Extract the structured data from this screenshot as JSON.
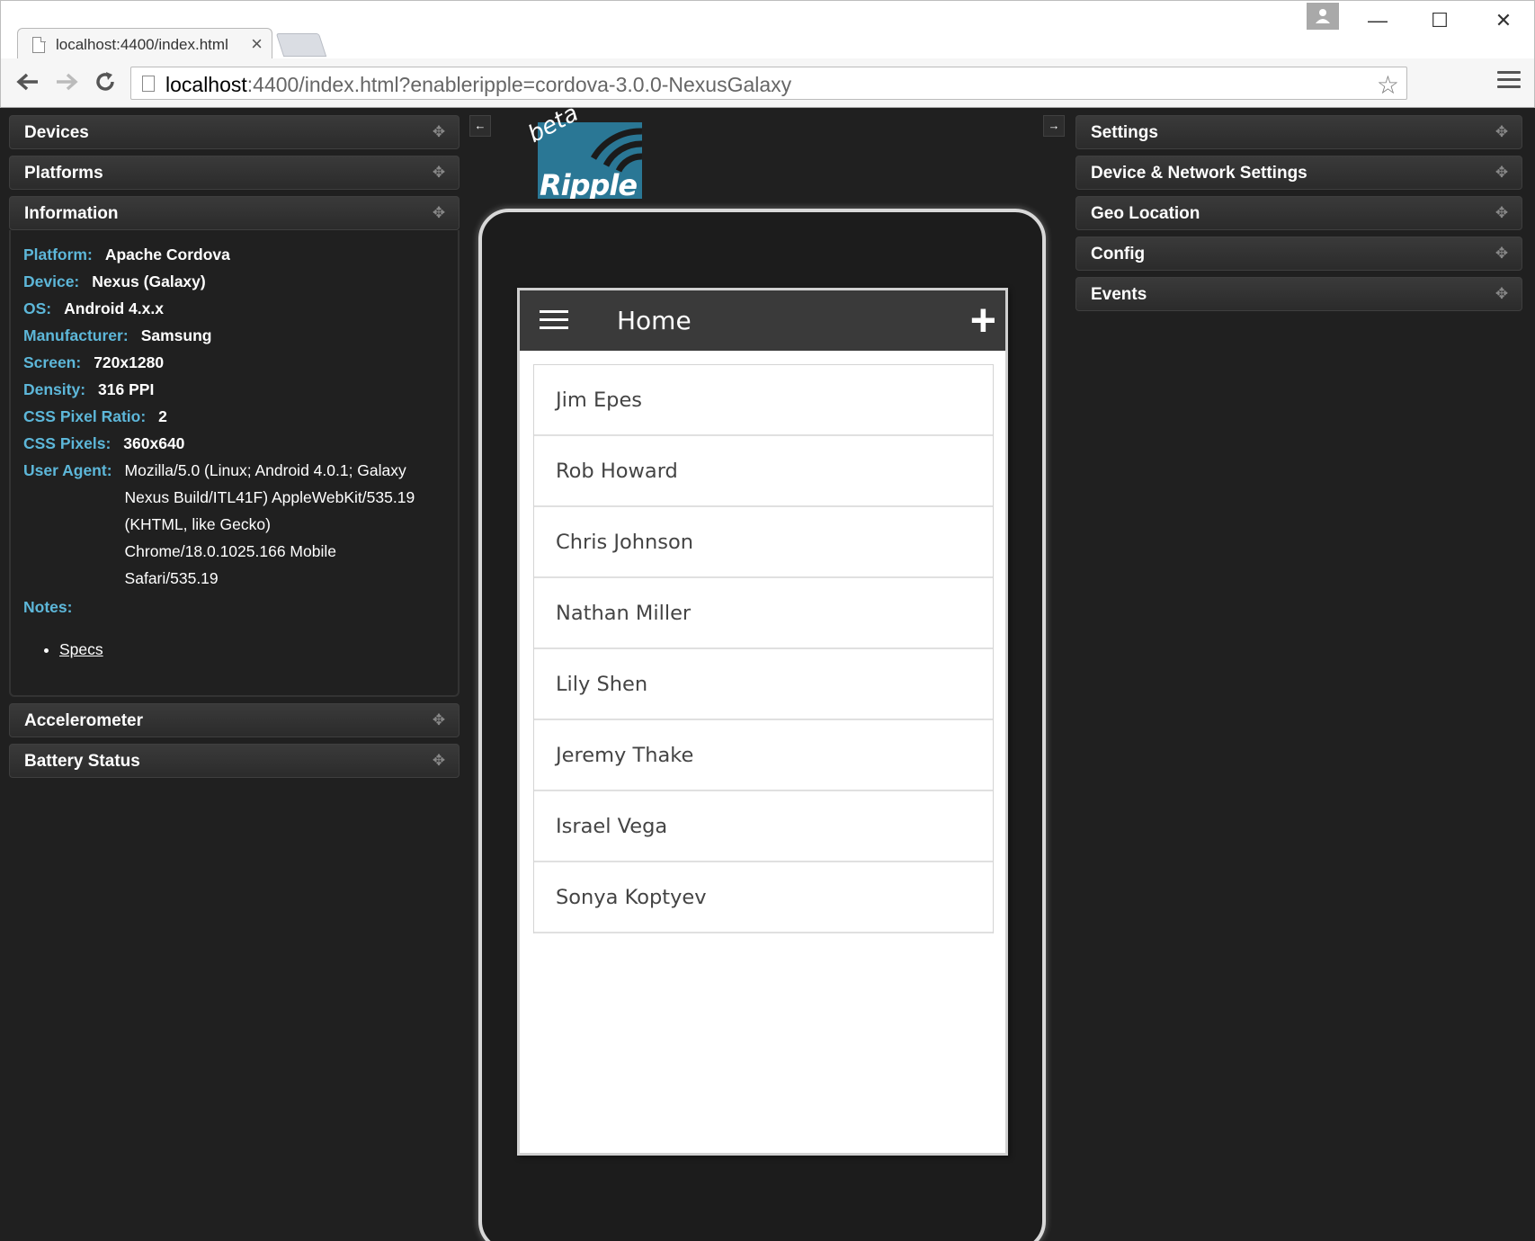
{
  "browser": {
    "tab_title": "localhost:4400/index.html",
    "tab_close": "×",
    "url_host": "localhost",
    "url_rest": ":4400/index.html?enableripple=cordova-3.0.0-NexusGalaxy",
    "star": "☆",
    "window": {
      "minimize": "—",
      "maximize": "☐",
      "close": "✕"
    }
  },
  "left_panels": {
    "devices": "Devices",
    "platforms": "Platforms",
    "information": "Information",
    "accelerometer": "Accelerometer",
    "battery": "Battery Status"
  },
  "info": {
    "rows": [
      {
        "label": "Platform:",
        "value": "Apache Cordova"
      },
      {
        "label": "Device:",
        "value": "Nexus (Galaxy)"
      },
      {
        "label": "OS:",
        "value": "Android 4.x.x"
      },
      {
        "label": "Manufacturer:",
        "value": "Samsung"
      },
      {
        "label": "Screen:",
        "value": "720x1280"
      },
      {
        "label": "Density:",
        "value": "316 PPI"
      },
      {
        "label": "CSS Pixel Ratio:",
        "value": "2"
      },
      {
        "label": "CSS Pixels:",
        "value": "360x640"
      }
    ],
    "user_agent_label": "User Agent:",
    "user_agent": "Mozilla/5.0 (Linux; Android 4.0.1; Galaxy Nexus Build/ITL41F) AppleWebKit/535.19 (KHTML, like Gecko) Chrome/18.0.1025.166 Mobile Safari/535.19",
    "notes_label": "Notes:",
    "specs_link": "Specs"
  },
  "right_panels": {
    "settings": "Settings",
    "device_network": "Device & Network Settings",
    "geo": "Geo Location",
    "config": "Config",
    "events": "Events"
  },
  "center": {
    "left_arrow": "←",
    "right_arrow": "→",
    "logo_beta": "beta",
    "logo_word": "Ripple"
  },
  "app": {
    "title": "Home",
    "add": "+",
    "contacts": [
      "Jim Epes",
      "Rob Howard",
      "Chris Johnson",
      "Nathan Miller",
      "Lily Shen",
      "Jeremy Thake",
      "Israel Vega",
      "Sonya Koptyev"
    ]
  },
  "icons": {
    "panel_move": "✥",
    "back": "arrow-left-icon",
    "forward": "arrow-right-icon",
    "reload": "reload-icon"
  },
  "colors": {
    "info_label": "#5db7d9",
    "background": "#202020",
    "logo": "#2a7795"
  }
}
